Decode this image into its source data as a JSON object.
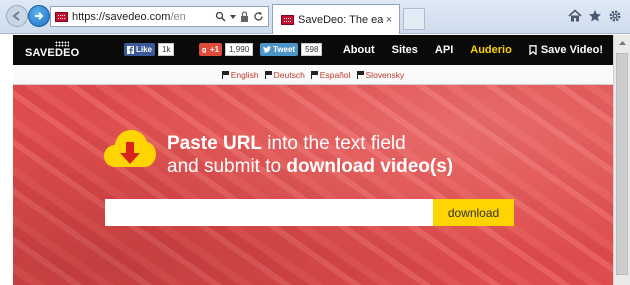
{
  "browser": {
    "url_main": "https://savedeo.com",
    "url_path": "/en",
    "tab_title": "SaveDeo: The easiest way...",
    "tab_close": "×",
    "icons": [
      "back-icon",
      "forward-icon",
      "search-icon",
      "lock-icon",
      "refresh-icon",
      "home-icon",
      "star-icon",
      "gear-icon"
    ]
  },
  "site": {
    "logo": "SAVEDEO",
    "social": {
      "facebook_label": "Like",
      "facebook_count": "1k",
      "google_label": "+1",
      "google_count": "1,990",
      "twitter_label": "Tweet",
      "twitter_count": "598"
    },
    "menu": {
      "about": "About",
      "sites": "Sites",
      "api": "API",
      "auderio": "Auderio",
      "save_video": "Save Video!"
    },
    "languages": [
      "English",
      "Deutsch",
      "Español",
      "Slovensky"
    ],
    "hero": {
      "line1_bold": "Paste URL",
      "line1_rest": " into the text field",
      "line2_start": "and submit to ",
      "line2_bold": "download video(s)",
      "input_placeholder": "",
      "download_label": "download"
    }
  },
  "colors": {
    "accent_yellow": "#ffd400",
    "hero_red": "#e44e50",
    "navbar_black": "#0a0a0a",
    "link_red": "#c0392b"
  }
}
